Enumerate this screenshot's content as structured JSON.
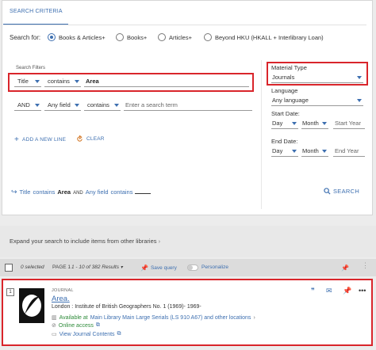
{
  "search_criteria": {
    "tab_label": "SEARCH CRITERIA",
    "search_for_label": "Search for:",
    "scopes": [
      {
        "label": "Books & Articles+",
        "selected": true
      },
      {
        "label": "Books+",
        "selected": false
      },
      {
        "label": "Articles+",
        "selected": false
      },
      {
        "label": "Beyond HKU (HKALL + Interlibrary Loan)",
        "selected": false
      }
    ],
    "filters_label": "Search Filters",
    "row1": {
      "field": "Title",
      "operator": "contains",
      "value": "Area"
    },
    "row2": {
      "boolean": "AND",
      "field": "Any field",
      "operator": "contains",
      "placeholder": "Enter a search term"
    },
    "add_line_label": "ADD A NEW LINE",
    "clear_label": "CLEAR",
    "material_type_label": "Material Type",
    "material_type_value": "Journals",
    "language_label": "Language",
    "language_value": "Any language",
    "start_date_label": "Start Date:",
    "start_day": "Day",
    "start_month": "Month",
    "start_year_placeholder": "Start Year",
    "end_date_label": "End Date:",
    "end_day": "Day",
    "end_month": "Month",
    "end_year_placeholder": "End Year",
    "summary": {
      "k1": "Title",
      "op1": "contains",
      "v1": "Area",
      "bool": "AND",
      "k2": "Any field",
      "op2": "contains"
    },
    "search_button": "SEARCH"
  },
  "expand_text": "Expand your search to include items from other libraries",
  "toolbar": {
    "selected_text": "0 selected",
    "page_text": "PAGE 1",
    "results_text": "1 - 10 of 382 Results",
    "save_query": "Save query",
    "personalize": "Personalize"
  },
  "result": {
    "number": "1",
    "type": "JOURNAL",
    "title": "Area.",
    "publisher": "London : Institute of British Geographers No. 1 (1969)- 1969-",
    "availability_status": "Available at",
    "availability_location": "Main Library  Main Large Serials (LS 910 A67) and other locations",
    "online_access": "Online access",
    "view_contents": "View Journal Contents"
  },
  "colors": {
    "accent": "#3d6fb0",
    "highlight_border": "#d9252b",
    "available": "#2e8b3a"
  }
}
